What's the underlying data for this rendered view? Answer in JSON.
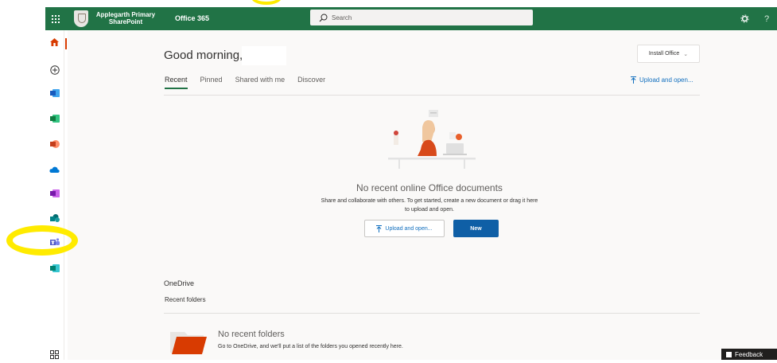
{
  "topbar": {
    "site_name": "Applegarth Primary SharePoint",
    "app_name": "Office 365",
    "search_placeholder": "Search",
    "help_label": "?"
  },
  "rail": {
    "items": [
      "home",
      "create",
      "word",
      "excel",
      "powerpoint",
      "onedrive",
      "onenote",
      "sharepoint",
      "teams",
      "sway",
      "all-apps"
    ]
  },
  "main": {
    "greeting": "Good morning,",
    "install_office": "Install Office",
    "tabs": [
      {
        "label": "Recent",
        "active": true
      },
      {
        "label": "Pinned",
        "active": false
      },
      {
        "label": "Shared with me",
        "active": false
      },
      {
        "label": "Discover",
        "active": false
      }
    ],
    "upload_open": "Upload and open...",
    "empty_title": "No recent online Office documents",
    "empty_desc_line1": "Share and collaborate with others. To get started, create a new document or drag it here",
    "empty_desc_line2": "to upload and open.",
    "upload_button": "Upload and open...",
    "new_button": "New",
    "onedrive_heading": "OneDrive",
    "recent_folders": "Recent folders",
    "no_folders_title": "No recent folders",
    "no_folders_desc": "Go to OneDrive, and we'll put a list of the folders you opened recently here."
  },
  "feedback_label": "Feedback",
  "colors": {
    "accent": "#217346",
    "link": "#106ebe",
    "new_button": "#0f5fa6",
    "highlight": "#ffeb00"
  }
}
